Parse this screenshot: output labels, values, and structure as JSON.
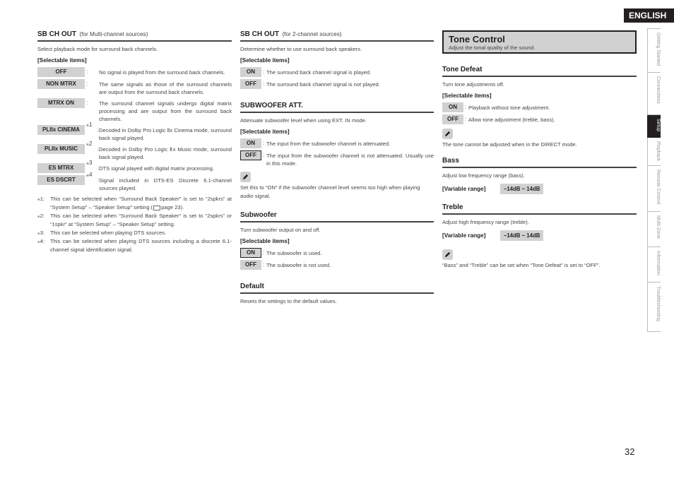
{
  "header": {
    "language": "ENGLISH"
  },
  "side_tabs": [
    {
      "label": "Getting Started",
      "active": false
    },
    {
      "label": "Connections",
      "active": false
    },
    {
      "label": "Setup",
      "active": true
    },
    {
      "label": "Playback",
      "active": false
    },
    {
      "label": "Remote Control",
      "active": false
    },
    {
      "label": "Multi-Zone",
      "active": false
    },
    {
      "label": "Information",
      "active": false
    },
    {
      "label": "Troubleshooting",
      "active": false
    }
  ],
  "page_number": "32",
  "sb_multi": {
    "title": "SB CH OUT",
    "subtitle": "(for Multi-channel sources)",
    "description": "Select playback mode for surround back channels.",
    "selectable_heading": "[Selectable items]",
    "items": [
      {
        "label": "OFF",
        "mark": "",
        "text": "No signal is played from the surround back channels."
      },
      {
        "label": "NON MTRX",
        "mark": "",
        "text": "The same signals as those of the surround channels are output from the surround back channels."
      },
      {
        "label": "MTRX ON",
        "mark": "",
        "text": "The surround channel signals undergo digital matrix processing and are output from the surround back channels."
      },
      {
        "label": "PLIIx CINEMA",
        "mark": "⁎1",
        "text": "Decoded in Dolby Pro Logic Ⅱx Cinema mode, surround back signal played."
      },
      {
        "label": "PLIIx MUSIC",
        "mark": "⁎2",
        "text": "Decoded in Dolby Pro Logic Ⅱx Music mode, surround back signal played."
      },
      {
        "label": "ES MTRX",
        "mark": "⁎3",
        "text": "DTS signal played with digital matrix processing."
      },
      {
        "label": "ES DSCRT",
        "mark": "⁎4",
        "text": "Signal included in DTS-ES Discrete 6.1-channel sources played."
      }
    ],
    "notes": [
      {
        "mark": "⁎1:",
        "text_a": "This can be selected when “Surround Back Speaker” is set to “2spkrs” at “System Setup” – “Speaker Setup” setting (",
        "text_b": "page 23)."
      },
      {
        "mark": "⁎2:",
        "text": "This can be selected when “Surround Back Speaker” is set to “2spkrs” or “1spkr” at “System Setup” – “Speaker Setup” setting."
      },
      {
        "mark": "⁎3:",
        "text": "This can be selected when playing DTS sources."
      },
      {
        "mark": "⁎4:",
        "text": "This can be selected when playing DTS sources including a discrete 6.1-channel signal identification signal."
      }
    ]
  },
  "sb_2ch": {
    "title": "SB CH OUT",
    "subtitle": "(for 2-channel sources)",
    "description": "Determine whether to use surround back speakers.",
    "selectable_heading": "[Selectable items]",
    "items": [
      {
        "label": "ON",
        "text": "The surround back channel signal is played."
      },
      {
        "label": "OFF",
        "text": "The surround back channel signal is not played."
      }
    ]
  },
  "sub_att": {
    "title": "SUBWOOFER ATT.",
    "description": "Attenuate subwoofer level when using EXT. IN mode.",
    "selectable_heading": "[Selectable items]",
    "items": [
      {
        "label": "ON",
        "text": "The input from the subwoofer channel is attenuated."
      },
      {
        "label": "OFF",
        "text": "The input from the subwoofer channel is not attenuated. Usually use in this mode."
      }
    ],
    "tip": "Set this to “ON” if the subwoofer channel level seems too high when playing audio signal."
  },
  "subwoofer": {
    "title": "Subwoofer",
    "description": "Turn subwoofer output on and off.",
    "selectable_heading": "[Selectable items]",
    "items": [
      {
        "label": "ON",
        "text": "The subwoofer is used."
      },
      {
        "label": "OFF",
        "text": "The subwoofer is not used."
      }
    ]
  },
  "default": {
    "title": "Default",
    "description": "Resets the settings to the default values."
  },
  "tone_control": {
    "title": "Tone Control",
    "subtitle": "Adjust the tonal quality of the sound."
  },
  "tone_defeat": {
    "title": "Tone Defeat",
    "description": "Turn tone adjustments off.",
    "selectable_heading": "[Selectable items]",
    "items": [
      {
        "label": "ON",
        "text": "Playback without tone adjustment."
      },
      {
        "label": "OFF",
        "text": "Allow tone adjustment (treble, bass)."
      }
    ],
    "tip": "The tone cannot be adjusted when in the DIRECT mode."
  },
  "bass": {
    "title": "Bass",
    "description": "Adjust low frequency range (bass).",
    "range_label": "[Variable range]",
    "range_value": "–14dB ~ 14dB"
  },
  "treble": {
    "title": "Treble",
    "description": "Adjust high frequency range (treble).",
    "range_label": "[Variable range]",
    "range_value": "–14dB ~ 14dB",
    "tip": "“Bass” and “Treble” can be set when “Tone Defeat” is set to “OFF”."
  }
}
